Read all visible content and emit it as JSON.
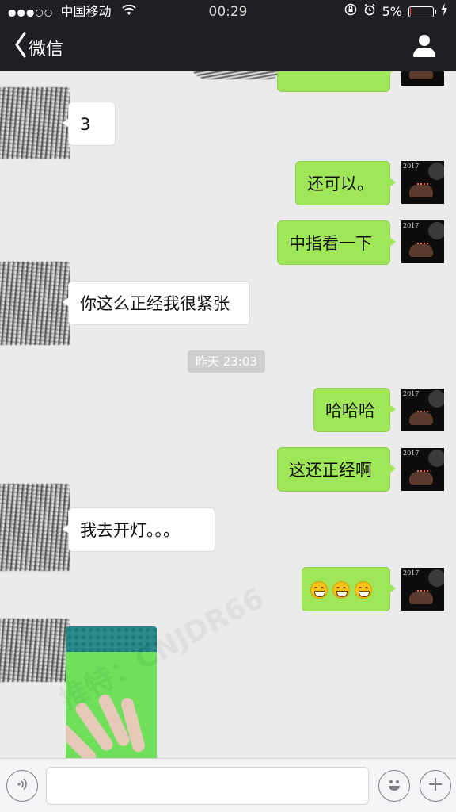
{
  "status_bar": {
    "signal": "●●●○○",
    "carrier": "中国移动",
    "time": "00:29",
    "battery": "5%",
    "battery_level": 0.05,
    "battery_color": "#ff3b30"
  },
  "nav": {
    "back_label": "微信",
    "right_icon": "profile-icon"
  },
  "messages": [
    {
      "side": "in",
      "text": "3"
    },
    {
      "side": "out",
      "text": "还可以。"
    },
    {
      "side": "out",
      "text": "中指看一下"
    },
    {
      "side": "in",
      "text": "你这么正经我很紧张"
    },
    {
      "side": "time",
      "text": "昨天 23:03"
    },
    {
      "side": "out",
      "text": "哈哈哈"
    },
    {
      "side": "out",
      "text": "这还正经啊"
    },
    {
      "side": "in",
      "text": "我去开灯。。。"
    },
    {
      "side": "out",
      "emoji": [
        "grin-icon",
        "grin-icon",
        "grin-icon"
      ]
    },
    {
      "side": "in",
      "image": "photo-hand-on-green"
    }
  ],
  "avatar_me": {
    "year": "2017"
  },
  "watermark": "推特：CNJDR66",
  "colors": {
    "nav_bg": "#1f2024",
    "chat_bg": "#ebebeb",
    "out_bubble": "#9fe658",
    "in_bubble": "#ffffff"
  },
  "input_bar": {
    "voice_icon": "voice-icon",
    "emoji_icon": "emoji-icon",
    "plus_icon": "plus-icon"
  }
}
